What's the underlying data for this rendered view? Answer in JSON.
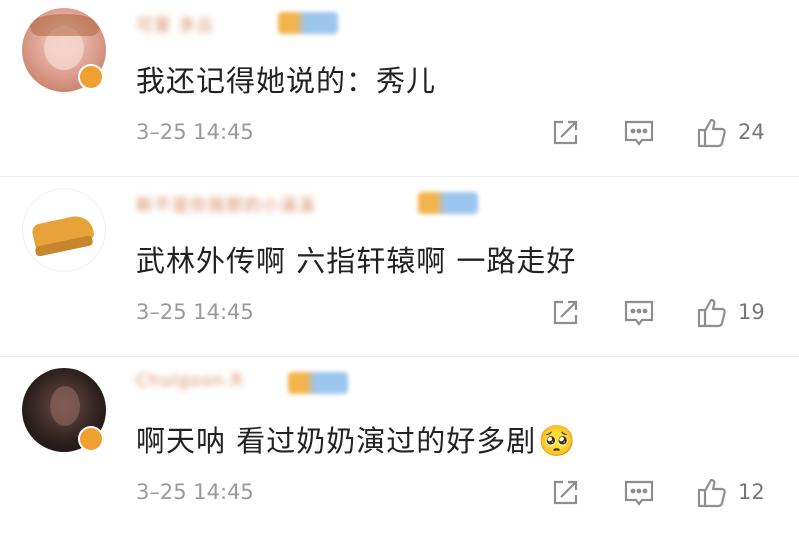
{
  "comments": [
    {
      "username": "可爱 多云",
      "text": "我还记得她说的：秀儿",
      "time": "3–25 14:45",
      "likes": "24"
    },
    {
      "username": "新不是你我那的小溪溪",
      "text": "武林外传啊 六指轩辕啊 一路走好",
      "time": "3–25 14:45",
      "likes": "19"
    },
    {
      "username": "Chulgoon.R",
      "text": "啊天呐  看过奶奶演过的好多剧",
      "emoji": "🥺",
      "time": "3–25 14:45",
      "likes": "12"
    }
  ],
  "icons": {
    "share": "share-icon",
    "reply": "comment-icon",
    "like": "thumbs-up-icon"
  },
  "colors": {
    "text": "#222222",
    "meta": "#9a9a9a",
    "username": "#d58b62"
  }
}
